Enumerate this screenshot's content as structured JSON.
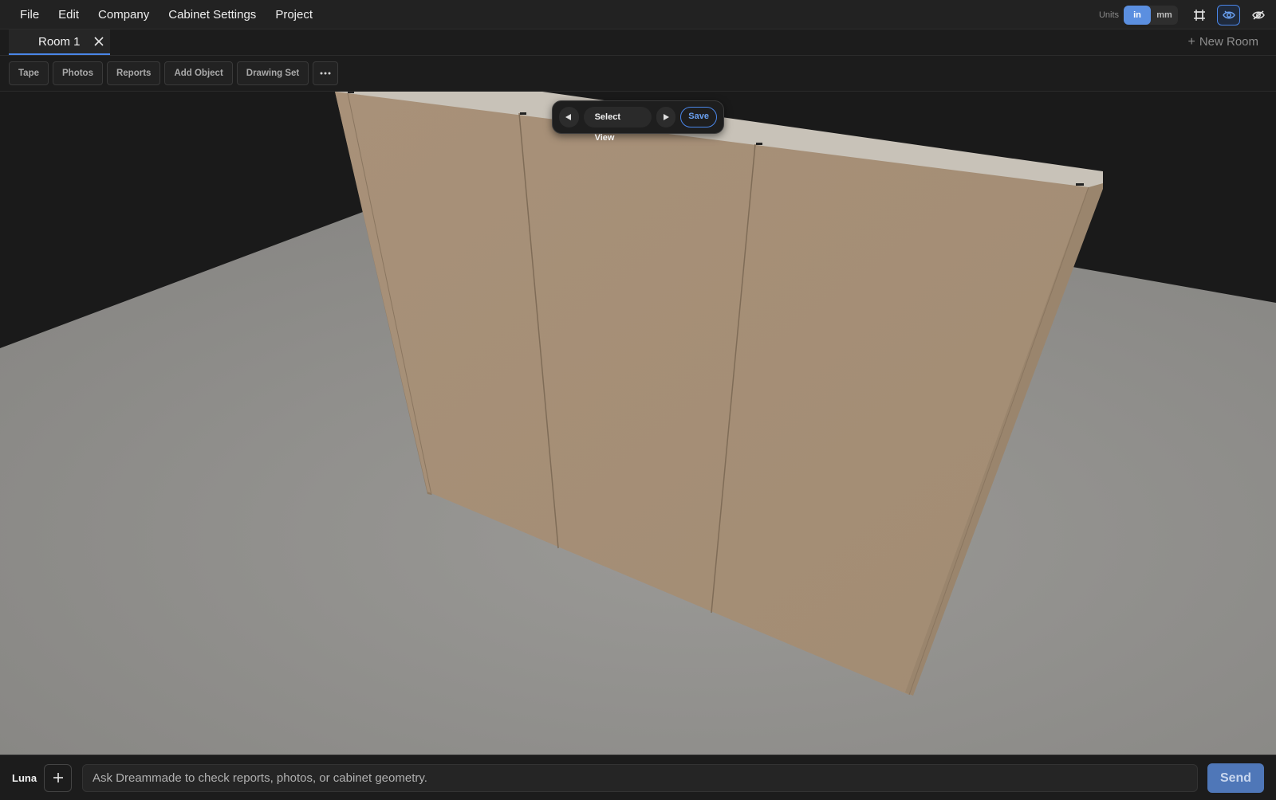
{
  "menu": {
    "items": [
      "File",
      "Edit",
      "Company",
      "Cabinet Settings",
      "Project"
    ]
  },
  "units": {
    "label": "Units",
    "options": [
      "in",
      "mm"
    ],
    "selected": "in"
  },
  "header_icons": [
    "frame-icon",
    "eye-icon",
    "eye-off-icon"
  ],
  "tabs": {
    "room_tab_label": "Room 1",
    "new_room_label": "New Room"
  },
  "toolbar": {
    "buttons": [
      "Tape",
      "Photos",
      "Reports",
      "Add Object",
      "Drawing Set"
    ]
  },
  "view_control": {
    "select_label": "Select View",
    "save_label": "Save"
  },
  "chat": {
    "assistant_name": "Luna",
    "placeholder": "Ask Dreammade to check reports, photos, or cabinet geometry.",
    "send_label": "Send"
  },
  "colors": {
    "accent": "#4a86e8",
    "cabinet_panel": "#a48e75",
    "floor": "#8f8e8b",
    "background": "#1b1b1b"
  }
}
